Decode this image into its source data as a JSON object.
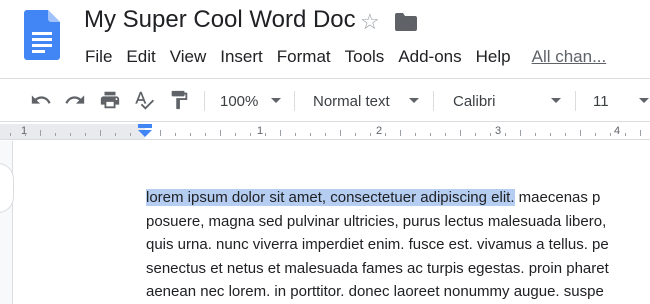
{
  "header": {
    "title": "My Super Cool Word Doc",
    "menu": [
      "File",
      "Edit",
      "View",
      "Insert",
      "Format",
      "Tools",
      "Add-ons",
      "Help"
    ],
    "all_changes_link": "All chan..."
  },
  "toolbar": {
    "zoom": "100%",
    "style": "Normal text",
    "font": "Calibri",
    "font_size": "11"
  },
  "ruler": {
    "labels": [
      "1",
      "1",
      "2",
      "3",
      "4"
    ]
  },
  "document": {
    "selected_text": "lorem ipsum dolor sit amet, consectetuer adipiscing elit.",
    "line1_rest": " maecenas p",
    "lines": [
      "posuere, magna sed pulvinar ultricies, purus lectus malesuada libero,",
      "quis urna. nunc viverra imperdiet enim. fusce est. vivamus a tellus. pe",
      "senectus et netus et malesuada fames ac turpis egestas. proin pharet",
      "aenean nec lorem. in porttitor. donec laoreet nonummy augue. suspe"
    ]
  },
  "colors": {
    "docs_blue": "#4285f4",
    "selection": "#b4cdf1",
    "text": "#202124",
    "icon_gray": "#5f6368"
  },
  "icons": [
    "docs-logo-icon",
    "star-icon",
    "folder-icon",
    "undo-icon",
    "redo-icon",
    "print-icon",
    "spellcheck-icon",
    "paint-format-icon",
    "indent-marker-icon"
  ]
}
